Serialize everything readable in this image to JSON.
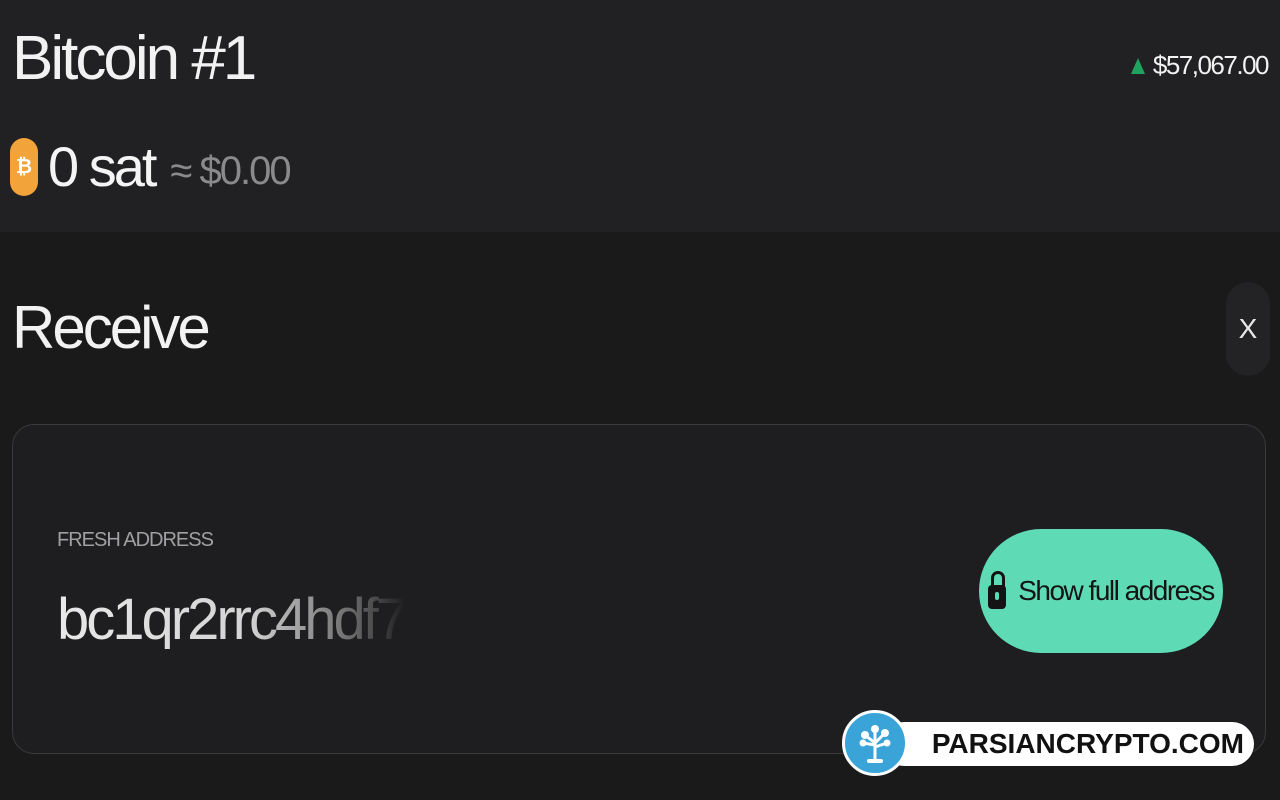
{
  "header": {
    "account_name": "Bitcoin #1",
    "price": "$57,067.00",
    "price_trend": "up",
    "price_trend_color": "#1fa35e",
    "balance": "0 sat",
    "balance_fiat": "≈ $0.00",
    "coin_icon": "bitcoin-icon",
    "coin_icon_glyph": "₿",
    "coin_color": "#f2a33a"
  },
  "receive": {
    "title": "Receive",
    "close_label": "X",
    "fresh_address_label": "FRESH ADDRESS",
    "address_preview": "bc1qr2rrc4hdf7",
    "show_button_label": "Show full address",
    "show_button_icon": "lock-icon",
    "accent_color": "#5edbb5"
  },
  "watermark": {
    "text": "PARSIANCRYPTO.COM",
    "logo_color": "#3aa3d8"
  }
}
